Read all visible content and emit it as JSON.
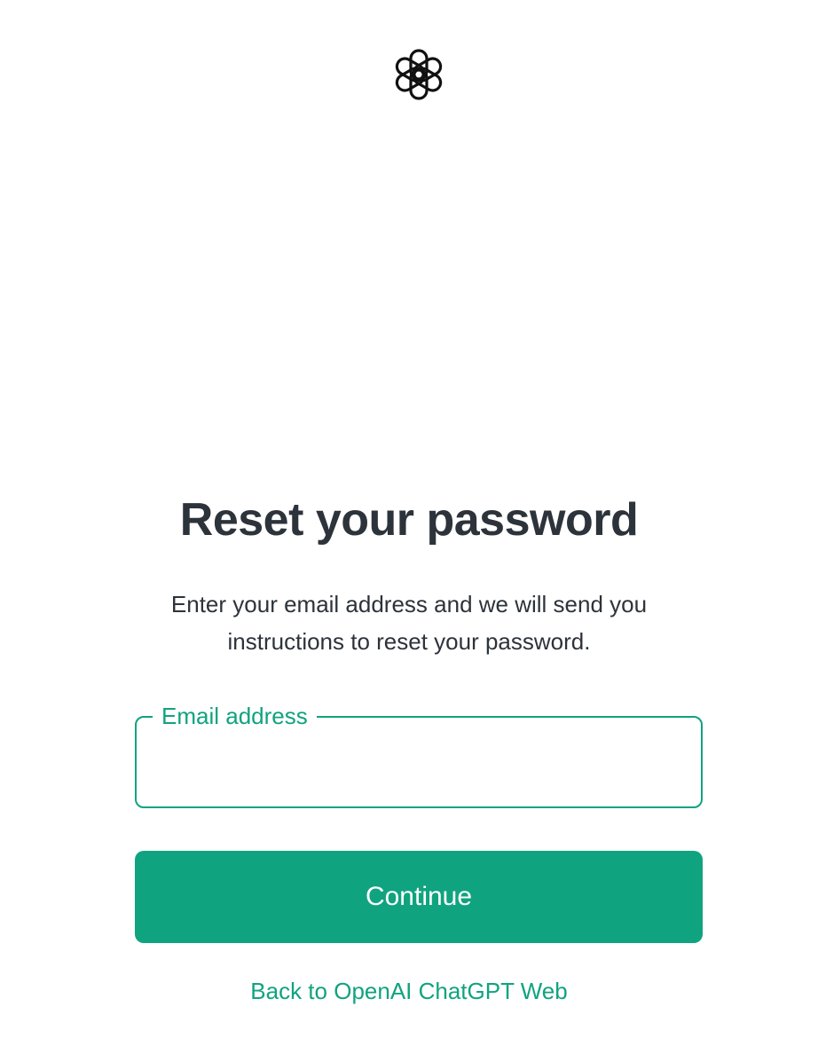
{
  "header": {
    "logo_icon": "openai-logo-icon"
  },
  "main": {
    "title": "Reset your password",
    "subtitle": "Enter your email address and we will send you instructions to reset your password.",
    "email_field": {
      "label": "Email address",
      "value": "",
      "placeholder": ""
    },
    "continue_label": "Continue",
    "back_link_label": "Back to OpenAI ChatGPT Web"
  },
  "colors": {
    "accent": "#10a37f",
    "text": "#2d333a",
    "background": "#ffffff"
  }
}
